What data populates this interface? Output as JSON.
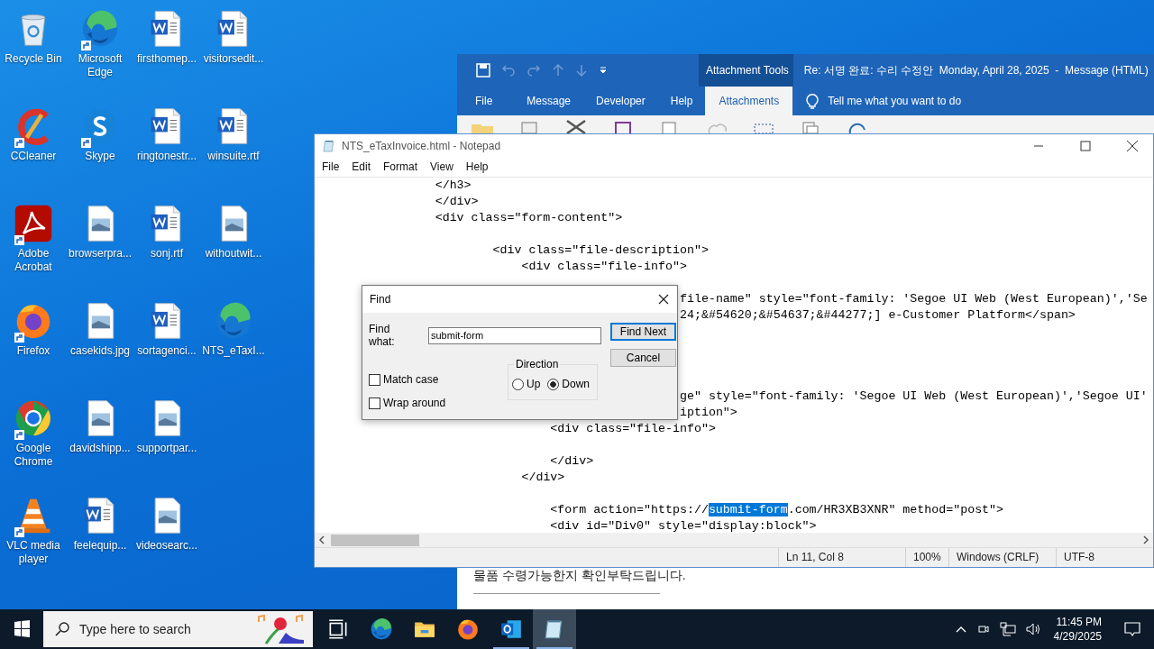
{
  "desktop_icons": [
    {
      "label": "Recycle Bin",
      "kind": "recycle",
      "shortcut": false
    },
    {
      "label": "CCleaner",
      "kind": "ccleaner",
      "shortcut": true
    },
    {
      "label": "Adobe Acrobat",
      "kind": "acrobat",
      "shortcut": true
    },
    {
      "label": "Firefox",
      "kind": "firefox",
      "shortcut": true
    },
    {
      "label": "Google Chrome",
      "kind": "chrome",
      "shortcut": true
    },
    {
      "label": "VLC media player",
      "kind": "vlc",
      "shortcut": true
    },
    {
      "label": "Microsoft Edge",
      "kind": "edge",
      "shortcut": true
    },
    {
      "label": "Skype",
      "kind": "skype",
      "shortcut": true
    },
    {
      "label": "browserpra...",
      "kind": "image",
      "shortcut": false
    },
    {
      "label": "casekids.jpg",
      "kind": "image",
      "shortcut": false
    },
    {
      "label": "davidshipp...",
      "kind": "image",
      "shortcut": false
    },
    {
      "label": "feelequip...",
      "kind": "word",
      "shortcut": false
    },
    {
      "label": "firsthomep...",
      "kind": "word",
      "shortcut": false
    },
    {
      "label": "ringtonestr...",
      "kind": "word",
      "shortcut": false
    },
    {
      "label": "sonj.rtf",
      "kind": "word",
      "shortcut": false
    },
    {
      "label": "sortagenci...",
      "kind": "word",
      "shortcut": false
    },
    {
      "label": "supportpar...",
      "kind": "image",
      "shortcut": false
    },
    {
      "label": "videosearc...",
      "kind": "image",
      "shortcut": false
    },
    {
      "label": "visitorsedit...",
      "kind": "word",
      "shortcut": false
    },
    {
      "label": "winsuite.rtf",
      "kind": "word",
      "shortcut": false
    },
    {
      "label": "withoutwit...",
      "kind": "image",
      "shortcut": false
    },
    {
      "label": "NTS_eTaxI...",
      "kind": "edge",
      "shortcut": false
    }
  ],
  "outlook": {
    "context_tab": "Attachment Tools",
    "title": "Re: 서명 완료: 수리 수정안  Monday, April 28, 2025  -  Message (HTML)",
    "tabs": [
      {
        "label": "File",
        "selected": false
      },
      {
        "label": "Message",
        "selected": false
      },
      {
        "label": "Developer",
        "selected": false
      },
      {
        "label": "Help",
        "selected": false
      },
      {
        "label": "Attachments",
        "selected": true
      }
    ],
    "tell_me": "Tell me what you want to do",
    "body_text": "물품 수령가능한지 확인부탁드립니다."
  },
  "notepad": {
    "title": "NTS_eTaxInvoice.html - Notepad",
    "menu": [
      "File",
      "Edit",
      "Format",
      "View",
      "Help"
    ],
    "lines": [
      {
        "text": "                </h3>"
      },
      {
        "text": "                </div>"
      },
      {
        "text": "                <div class=\"form-content\">"
      },
      {
        "kind": "blank"
      },
      {
        "text": "                        <div class=\"file-description\">"
      },
      {
        "text": "                            <div class=\"file-info\">"
      },
      {
        "kind": "blank"
      },
      {
        "text": "                                                  file-name\" style=\"font-family: 'Segoe UI Web (West European)','Se"
      },
      {
        "text": "                                                  24;&#54620;&#54637;&#44277;] e-Customer Platform</span>"
      },
      {
        "kind": "blank"
      },
      {
        "kind": "blank"
      },
      {
        "kind": "blank"
      },
      {
        "kind": "blank"
      },
      {
        "text": "                                                  ge\" style=\"font-family: 'Segoe UI Web (West European)','Segoe UI'"
      },
      {
        "text": "                                                  iption\">"
      },
      {
        "text": "                                <div class=\"file-info\">"
      },
      {
        "kind": "blank"
      },
      {
        "text": "                                </div>"
      },
      {
        "text": "                            </div>"
      },
      {
        "kind": "blank"
      },
      {
        "parts": [
          {
            "text": "                                <form action=\"https://",
            "selected": false
          },
          {
            "text": "submit-form",
            "selected": true
          },
          {
            "text": ".com/HR3XB3XNR\" method=\"post\">",
            "selected": false
          }
        ]
      },
      {
        "text": "                                <div id=\"Div0\" style=\"display:block\">"
      }
    ],
    "status": {
      "position": "Ln 11, Col 8",
      "zoom": "100%",
      "line_endings": "Windows (CRLF)",
      "encoding": "UTF-8"
    }
  },
  "find_dialog": {
    "title": "Find",
    "find_what_label": "Find what:",
    "find_what_value": "submit-form",
    "find_next": "Find Next",
    "cancel": "Cancel",
    "direction_label": "Direction",
    "directions": [
      {
        "label": "Up",
        "selected": false
      },
      {
        "label": "Down",
        "selected": true
      }
    ],
    "options": [
      {
        "label": "Match case",
        "checked": false
      },
      {
        "label": "Wrap around",
        "checked": false
      }
    ]
  },
  "taskbar": {
    "search_placeholder": "Type here to search",
    "apps": [
      {
        "kind": "taskview",
        "running": false,
        "selected": false
      },
      {
        "kind": "edge",
        "running": false,
        "selected": false
      },
      {
        "kind": "folder",
        "running": false,
        "selected": false
      },
      {
        "kind": "firefox",
        "running": false,
        "selected": false
      },
      {
        "kind": "outlook",
        "running": true,
        "selected": false
      },
      {
        "kind": "notepad",
        "running": true,
        "selected": true
      }
    ],
    "time": "11:45 PM",
    "date": "4/29/2025"
  }
}
